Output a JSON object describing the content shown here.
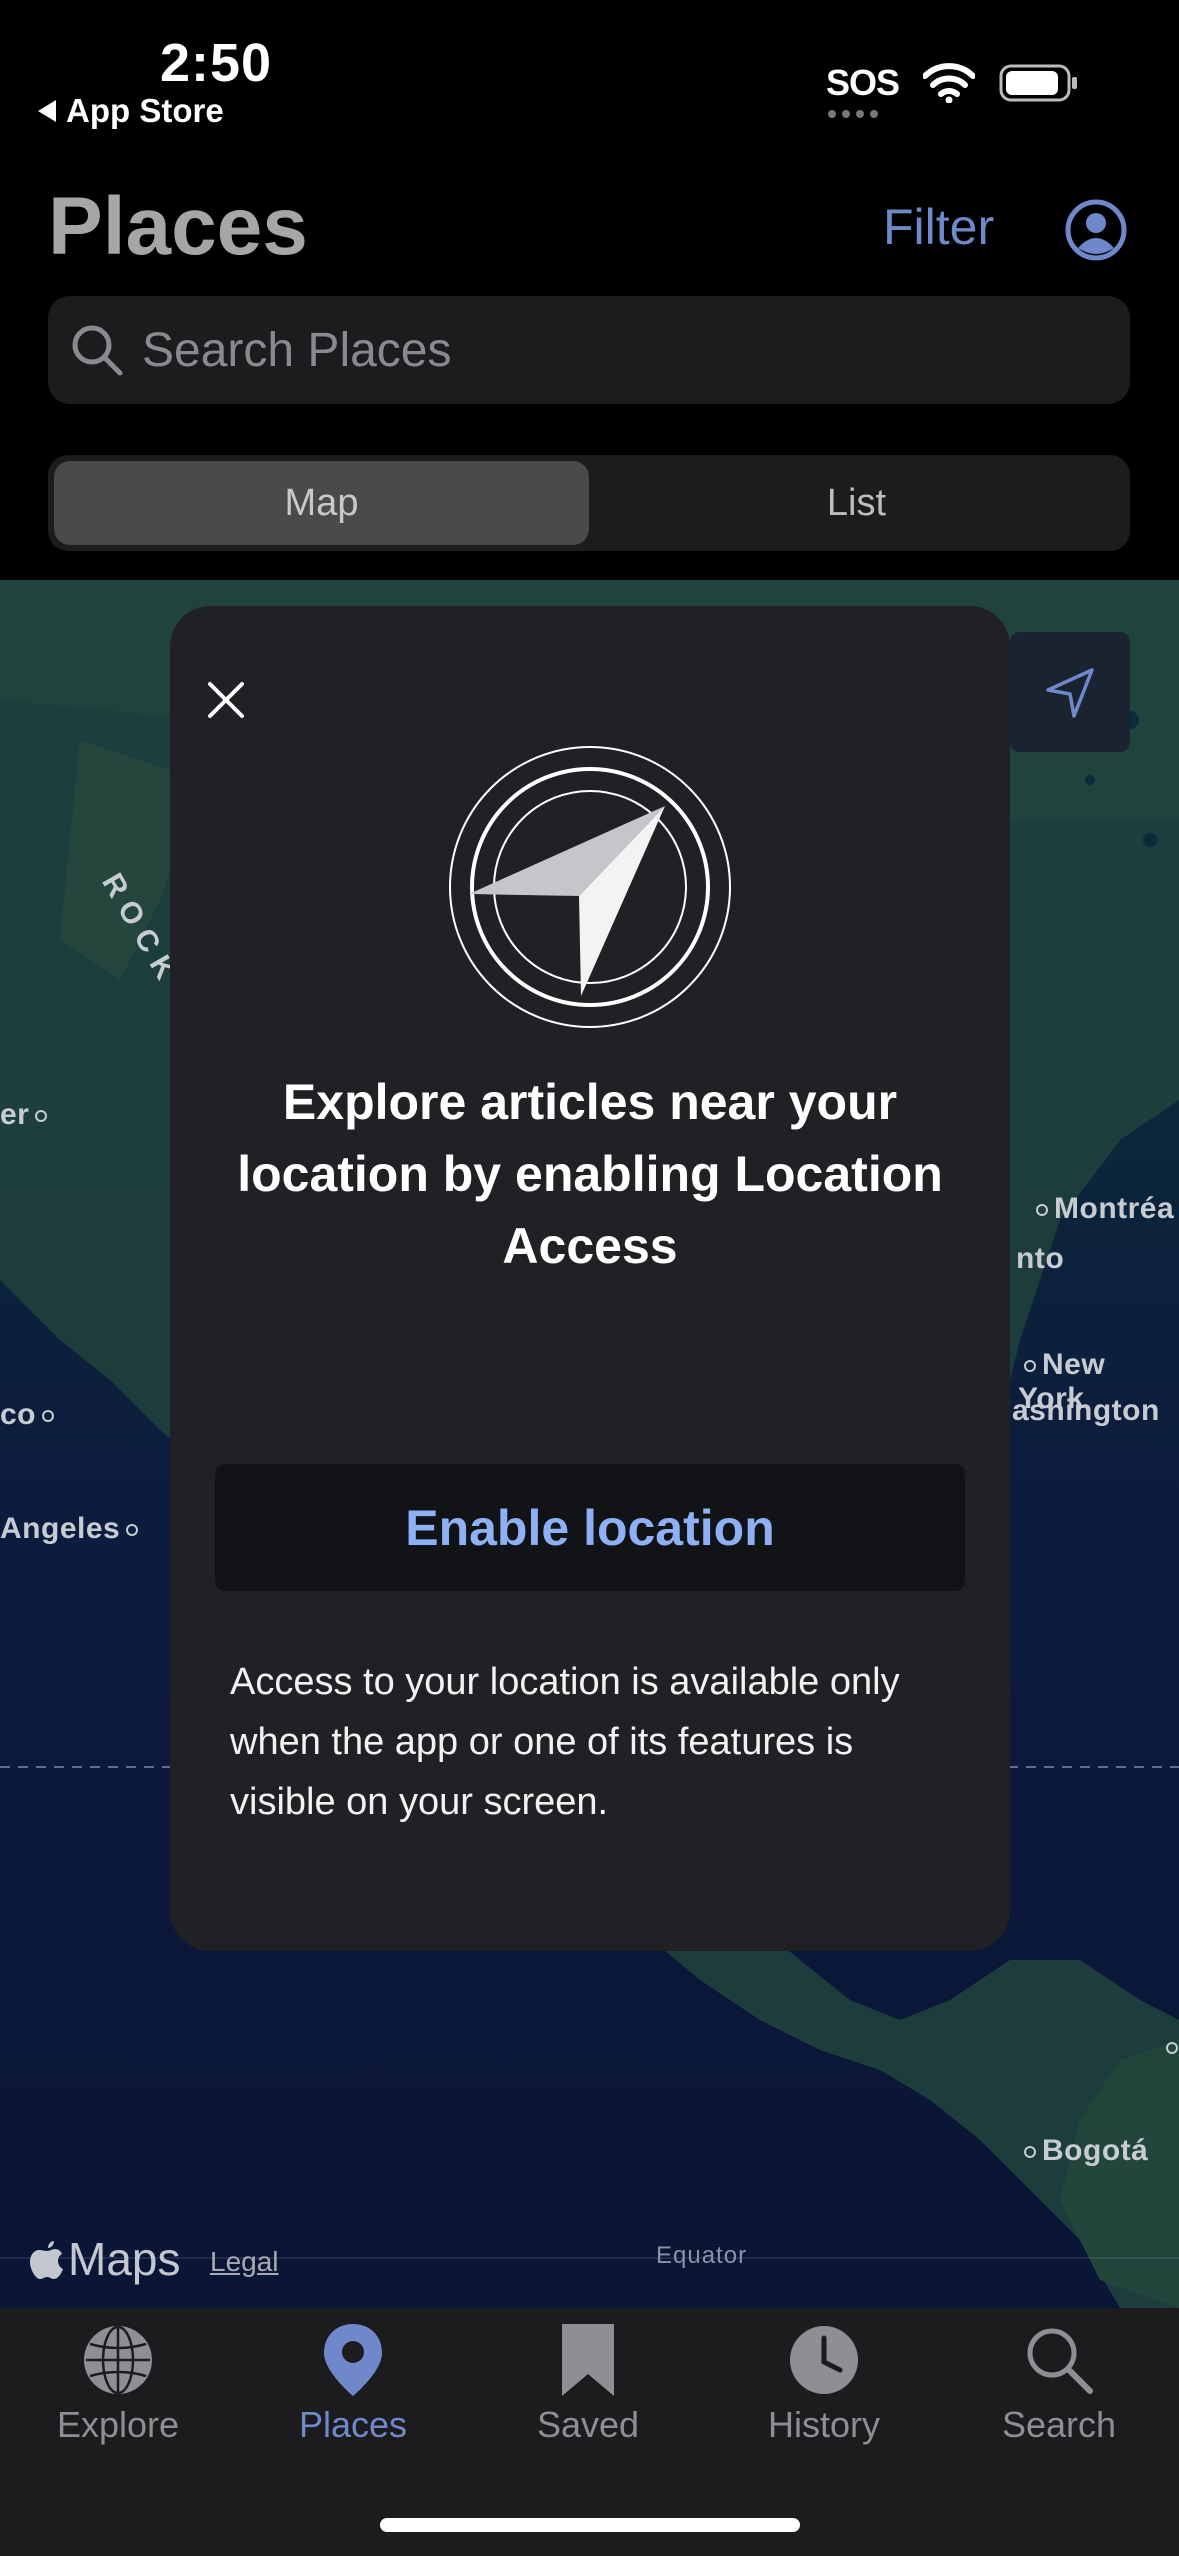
{
  "status_bar": {
    "time": "2:50",
    "back_label": "App Store",
    "sos": "SOS"
  },
  "header": {
    "title": "Places",
    "filter_label": "Filter"
  },
  "search": {
    "placeholder": "Search Places"
  },
  "segmented": {
    "items": [
      {
        "label": "Map",
        "selected": true
      },
      {
        "label": "List",
        "selected": false
      }
    ]
  },
  "map": {
    "labels": {
      "montreal": "Montréa",
      "toronto": "nto",
      "new_york": "New York",
      "washington": "ashington",
      "los_angeles": "Angeles",
      "mexico": "co",
      "west": "er",
      "bogota": "Bogotá",
      "rockies": "R O C K"
    },
    "attribution": "Maps",
    "legal": "Legal",
    "equator": "Equator"
  },
  "modal": {
    "title": "Explore articles near your location by enabling Location Access",
    "button_label": "Enable location",
    "note": "Access to your location is available only when the app or one of its features is visible on your screen."
  },
  "tabbar": {
    "items": [
      {
        "label": "Explore",
        "icon": "globe-icon",
        "active": false
      },
      {
        "label": "Places",
        "icon": "map-pin-icon",
        "active": true
      },
      {
        "label": "Saved",
        "icon": "bookmark-icon",
        "active": false
      },
      {
        "label": "History",
        "icon": "clock-icon",
        "active": false
      },
      {
        "label": "Search",
        "icon": "magnifier-icon",
        "active": false
      }
    ]
  },
  "colors": {
    "accent": "#6e88c9",
    "button_text": "#8db1f4",
    "modal_bg": "#202124"
  }
}
